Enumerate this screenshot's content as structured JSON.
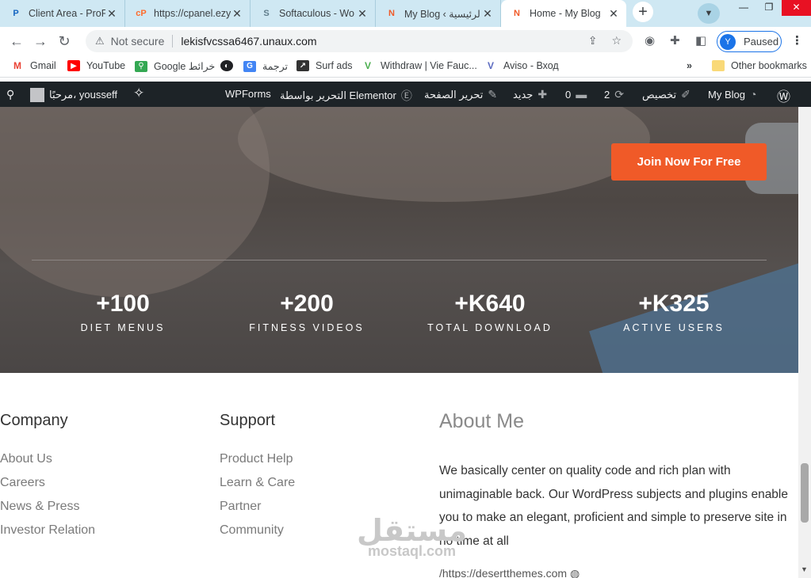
{
  "browser": {
    "tabs": [
      {
        "title": "Client Area - ProF",
        "favicon": "P"
      },
      {
        "title": "https://cpanel.ezy",
        "favicon": "cP"
      },
      {
        "title": "Softaculous - Wo",
        "favicon": "S"
      },
      {
        "title": "My Blog ‹ الرئيسية",
        "favicon": "N"
      },
      {
        "title": "Home - My Blog",
        "favicon": "N"
      }
    ],
    "new_tab": "+",
    "address": {
      "security": "Not secure",
      "url": "lekisfvcssa6467.unaux.com"
    },
    "profile": {
      "initial": "Y",
      "status": "Paused"
    },
    "bookmarks": [
      {
        "label": "Gmail",
        "icon": "gmail-icon",
        "color": "#ea4335"
      },
      {
        "label": "YouTube",
        "icon": "youtube-icon",
        "color": "#ff0000"
      },
      {
        "label": "Google خرائط",
        "icon": "maps-icon",
        "color": "#34a853"
      },
      {
        "label": "",
        "icon": "globe-icon",
        "color": "#202124"
      },
      {
        "label": "ترجمة",
        "icon": "translate-icon",
        "color": "#4285f4"
      },
      {
        "label": "Surf ads",
        "icon": "surfads-icon",
        "color": "#333333"
      },
      {
        "label": "Withdraw | Vie Fauc...",
        "icon": "vie-icon",
        "color": "#4caf50"
      },
      {
        "label": "Aviso - Вход",
        "icon": "aviso-icon",
        "color": "#5c6bc0"
      }
    ],
    "other_bookmarks": "Other bookmarks"
  },
  "wp_admin_bar": {
    "greeting": "مرحبًا، yousseff",
    "wpforms": "WPForms",
    "elementor": "التحرير بواسطة Elementor",
    "edit_page": "تحرير الصفحة",
    "new": "جديد",
    "comments": "0",
    "updates": "2",
    "customize": "تخصيص",
    "site_name": "My Blog"
  },
  "hero": {
    "cta": "Join Now For Free",
    "stats": [
      {
        "number": "+100",
        "label": "DIET MENUS"
      },
      {
        "number": "+200",
        "label": "FITNESS VIDEOS"
      },
      {
        "number": "+K640",
        "label": "TOTAL DOWNLOAD"
      },
      {
        "number": "+K325",
        "label": "ACTIVE USERS"
      }
    ]
  },
  "footer": {
    "company": {
      "heading": "Company",
      "links": [
        "About Us",
        "Careers",
        "News & Press",
        "Investor Relation"
      ]
    },
    "support": {
      "heading": "Support",
      "links": [
        "Product Help",
        "Learn & Care",
        "Partner",
        "Community"
      ]
    },
    "about": {
      "heading": "About Me",
      "text": "We basically center on quality code and rich plan with unimaginable back. Our WordPress subjects and plugins enable you to make an elegant, proficient and simple to preserve site in no time at all",
      "link": "/https://desertthemes.com"
    }
  },
  "watermark": {
    "arabic": "مستقل",
    "latin": "mostaql.com"
  },
  "colors": {
    "accent": "#f05a28",
    "wpbar": "#1d2327",
    "tabstrip": "#cfe8f3"
  }
}
